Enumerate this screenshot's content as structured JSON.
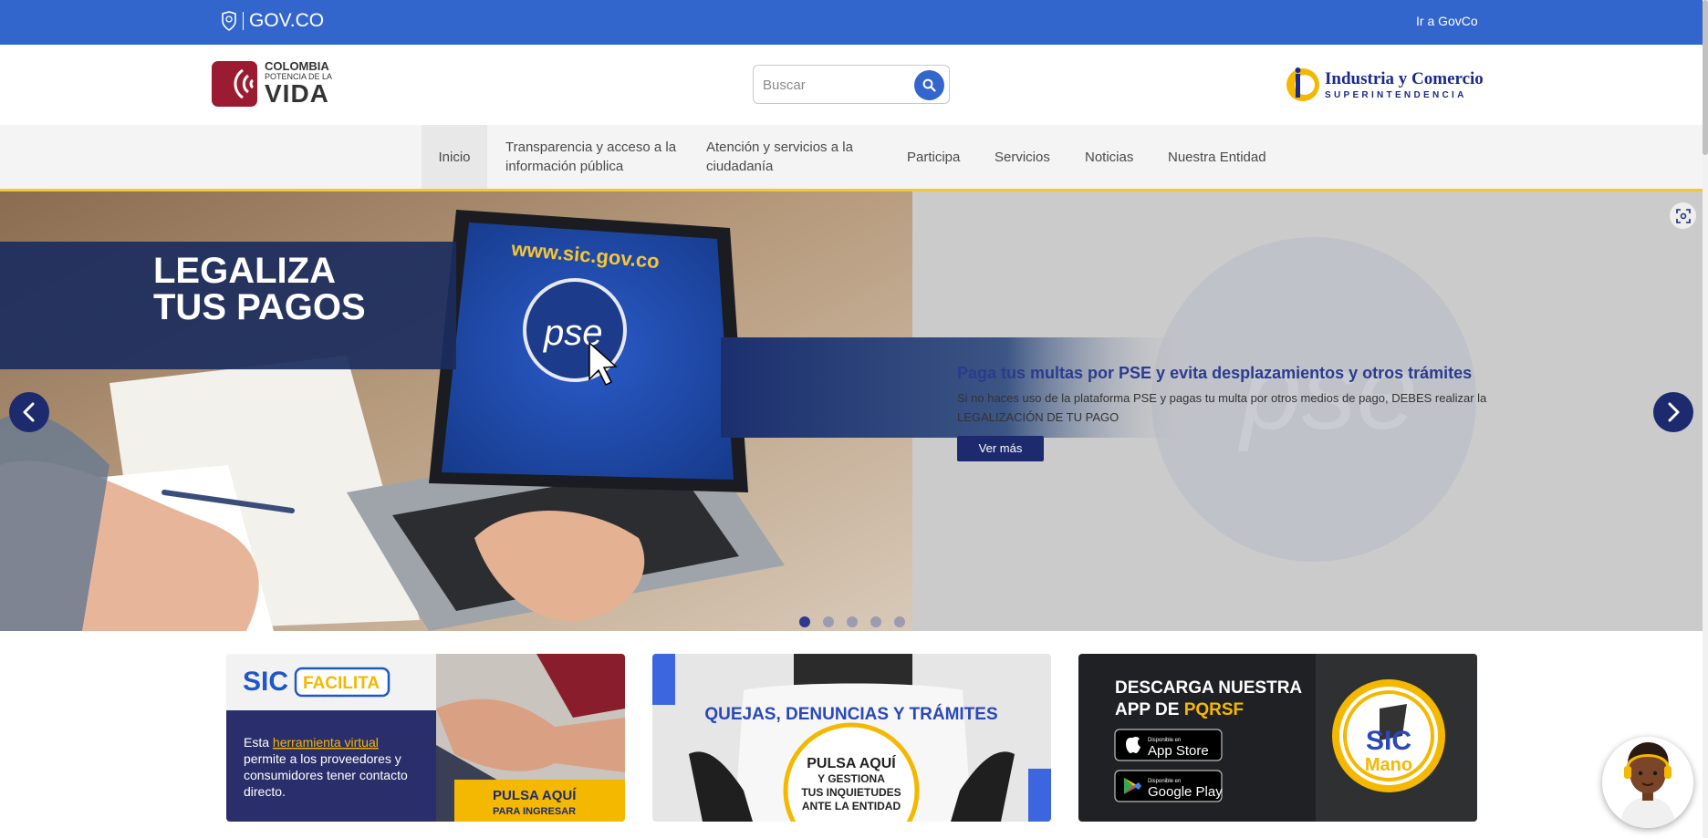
{
  "govbar": {
    "logo_text": "GOV.CO",
    "link": "Ir a GovCo"
  },
  "header": {
    "logo_line1": "COLOMBIA",
    "logo_line2": "POTENCIA DE LA",
    "logo_line3": "VIDA",
    "search_placeholder": "Buscar",
    "entity_line1": "Industria y Comercio",
    "entity_line2": "SUPERINTENDENCIA"
  },
  "nav": {
    "items": [
      {
        "label": "Inicio"
      },
      {
        "label": "Transparencia y acceso a la información pública"
      },
      {
        "label": "Atención y servicios a la ciudadanía"
      },
      {
        "label": "Participa"
      },
      {
        "label": "Servicios"
      },
      {
        "label": "Noticias"
      },
      {
        "label": "Nuestra Entidad"
      }
    ]
  },
  "carousel": {
    "image_text1": "LEGALIZA",
    "image_text2": "TUS PAGOS",
    "image_url_text": "www.sic.gov.co",
    "image_pse_text": "pse",
    "title": "Paga tus multas por PSE y evita desplazamientos y otros trámites",
    "description": "Si no haces uso de la plataforma PSE y pagas tu multa por otros medios de pago, DEBES realizar la LEGALIZACIÓN DE TU PAGO",
    "button": "Ver más",
    "active_slide": 1,
    "slide_count": 5
  },
  "cards": {
    "sic_facilita": {
      "brand1": "SIC",
      "brand2": "FACILITA",
      "text_pre": "Esta ",
      "text_link": "herramienta virtual",
      "text_post": "permite a los proveedores y consumidores tener contacto directo.",
      "cta1": "PULSA AQUÍ",
      "cta2": "PARA INGRESAR"
    },
    "quejas": {
      "title": "QUEJAS, DENUNCIAS Y TRÁMITES",
      "cta1": "PULSA AQUÍ",
      "cta2": "Y GESTIONA",
      "cta3": "TUS INQUIETUDES",
      "cta4": "ANTE LA ENTIDAD"
    },
    "app": {
      "line1": "DESCARGA NUESTRA",
      "line2a": "APP DE ",
      "line2b": "PQRSF",
      "appstore_small": "Disponible en",
      "appstore": "App Store",
      "googleplay_small": "Disponible en",
      "googleplay": "Google Play",
      "badge1": "SIC",
      "badge2": "Mano"
    }
  },
  "colors": {
    "gov_blue": "#3366cc",
    "navy": "#1d2b6e",
    "accent_yellow": "#f5c636"
  }
}
